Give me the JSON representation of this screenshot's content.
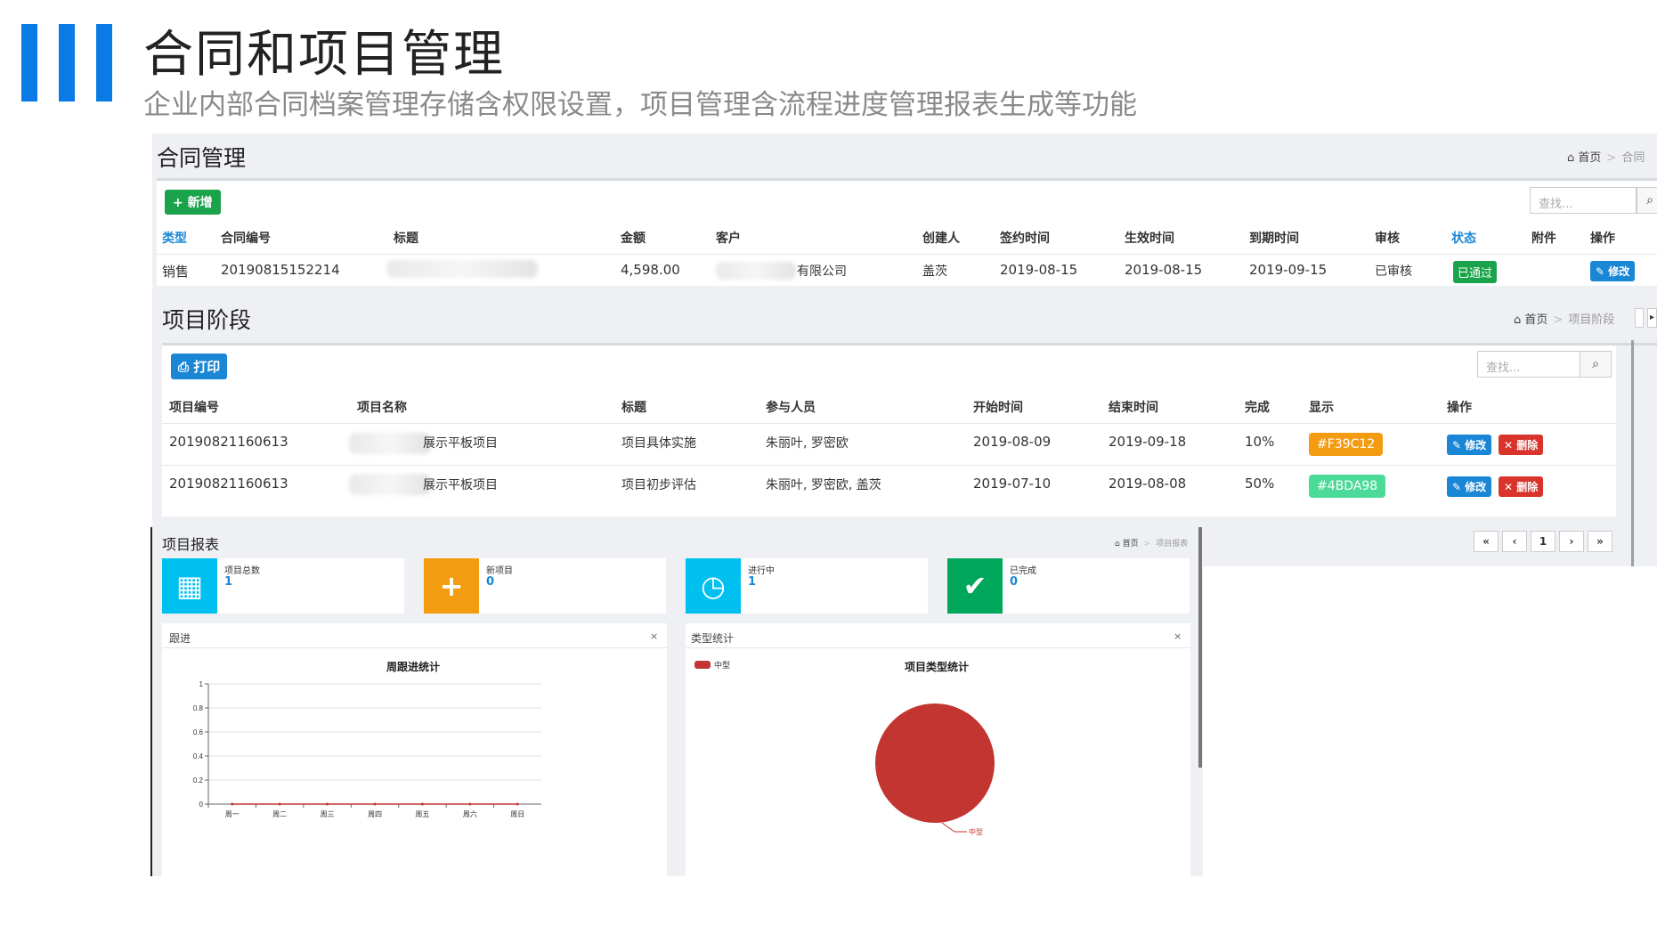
{
  "slide": {
    "title": "合同和项目管理",
    "subtitle": "企业内部合同档案管理存储含权限设置，项目管理含流程进度管理报表生成等功能"
  },
  "contract": {
    "header": "合同管理",
    "breadcrumb": [
      "首页",
      "合同"
    ],
    "add_button": "+ 新增",
    "search_placeholder": "查找...",
    "columns": [
      "类型",
      "合同编号",
      "标题",
      "金额",
      "客户",
      "创建人",
      "签约时间",
      "生效时间",
      "到期时间",
      "审核",
      "状态",
      "附件",
      "操作"
    ],
    "row": {
      "type": "销售",
      "number": "20190815152214",
      "amount": "4,598.00",
      "customer": "有限公司",
      "creator": "盖茨",
      "sign": "2019-08-15",
      "effective": "2019-08-15",
      "expire": "2019-09-15",
      "review": "已审核",
      "status": "已通过",
      "action": "修改"
    }
  },
  "project": {
    "header": "项目阶段",
    "breadcrumb": [
      "首页",
      "项目阶段"
    ],
    "print_button": "打印",
    "search_placeholder": "查找...",
    "columns": [
      "项目编号",
      "项目名称",
      "标题",
      "参与人员",
      "开始时间",
      "结束时间",
      "完成",
      "显示",
      "操作"
    ],
    "rows": [
      {
        "number": "20190821160613",
        "name": "展示平板项目",
        "title": "项目具体实施",
        "members": "朱丽叶, 罗密欧",
        "start": "2019-08-09",
        "end": "2019-09-18",
        "done": "10%",
        "color_label": "#F39C12",
        "color": "#F39C12",
        "edit": "修改",
        "delete": "删除"
      },
      {
        "number": "20190821160613",
        "name": "展示平板项目",
        "title": "项目初步评估",
        "members": "朱丽叶, 罗密欧, 盖茨",
        "start": "2019-07-10",
        "end": "2019-08-08",
        "done": "50%",
        "color_label": "#4BDA98",
        "color": "#4BDA98",
        "edit": "修改",
        "delete": "删除"
      }
    ],
    "pager": [
      "«",
      "‹",
      "1",
      "›",
      "»"
    ]
  },
  "report": {
    "header": "项目报表",
    "breadcrumb": [
      "首页",
      "项目报表"
    ],
    "stats": [
      {
        "label": "项目总数",
        "value": "1",
        "color": "#00c0ef",
        "icon": "cubes-icon"
      },
      {
        "label": "新项目",
        "value": "0",
        "color": "#f39c12",
        "icon": "plus-icon"
      },
      {
        "label": "进行中",
        "value": "1",
        "color": "#00c0ef",
        "icon": "clock-icon"
      },
      {
        "label": "已完成",
        "value": "0",
        "color": "#00a65a",
        "icon": "check-icon"
      }
    ],
    "line_panel": {
      "head": "跟进",
      "close": "×"
    },
    "pie_panel": {
      "head": "类型统计",
      "close": "×"
    }
  },
  "chart_data": [
    {
      "type": "line",
      "title": "周跟进统计",
      "categories": [
        "周一",
        "周二",
        "周三",
        "周四",
        "周五",
        "周六",
        "周日"
      ],
      "series": [
        {
          "values": [
            0,
            0,
            0,
            0,
            0,
            0,
            0
          ],
          "color": "#c23531"
        }
      ],
      "ylim": [
        0,
        1
      ],
      "yticks": [
        "0",
        "0.2",
        "0.4",
        "0.6",
        "0.8",
        "1"
      ],
      "grid": true
    },
    {
      "type": "pie",
      "title": "项目类型统计",
      "slices": [
        {
          "name": "中型",
          "value": 1,
          "color": "#c23531"
        }
      ],
      "legend": "top-left"
    }
  ]
}
